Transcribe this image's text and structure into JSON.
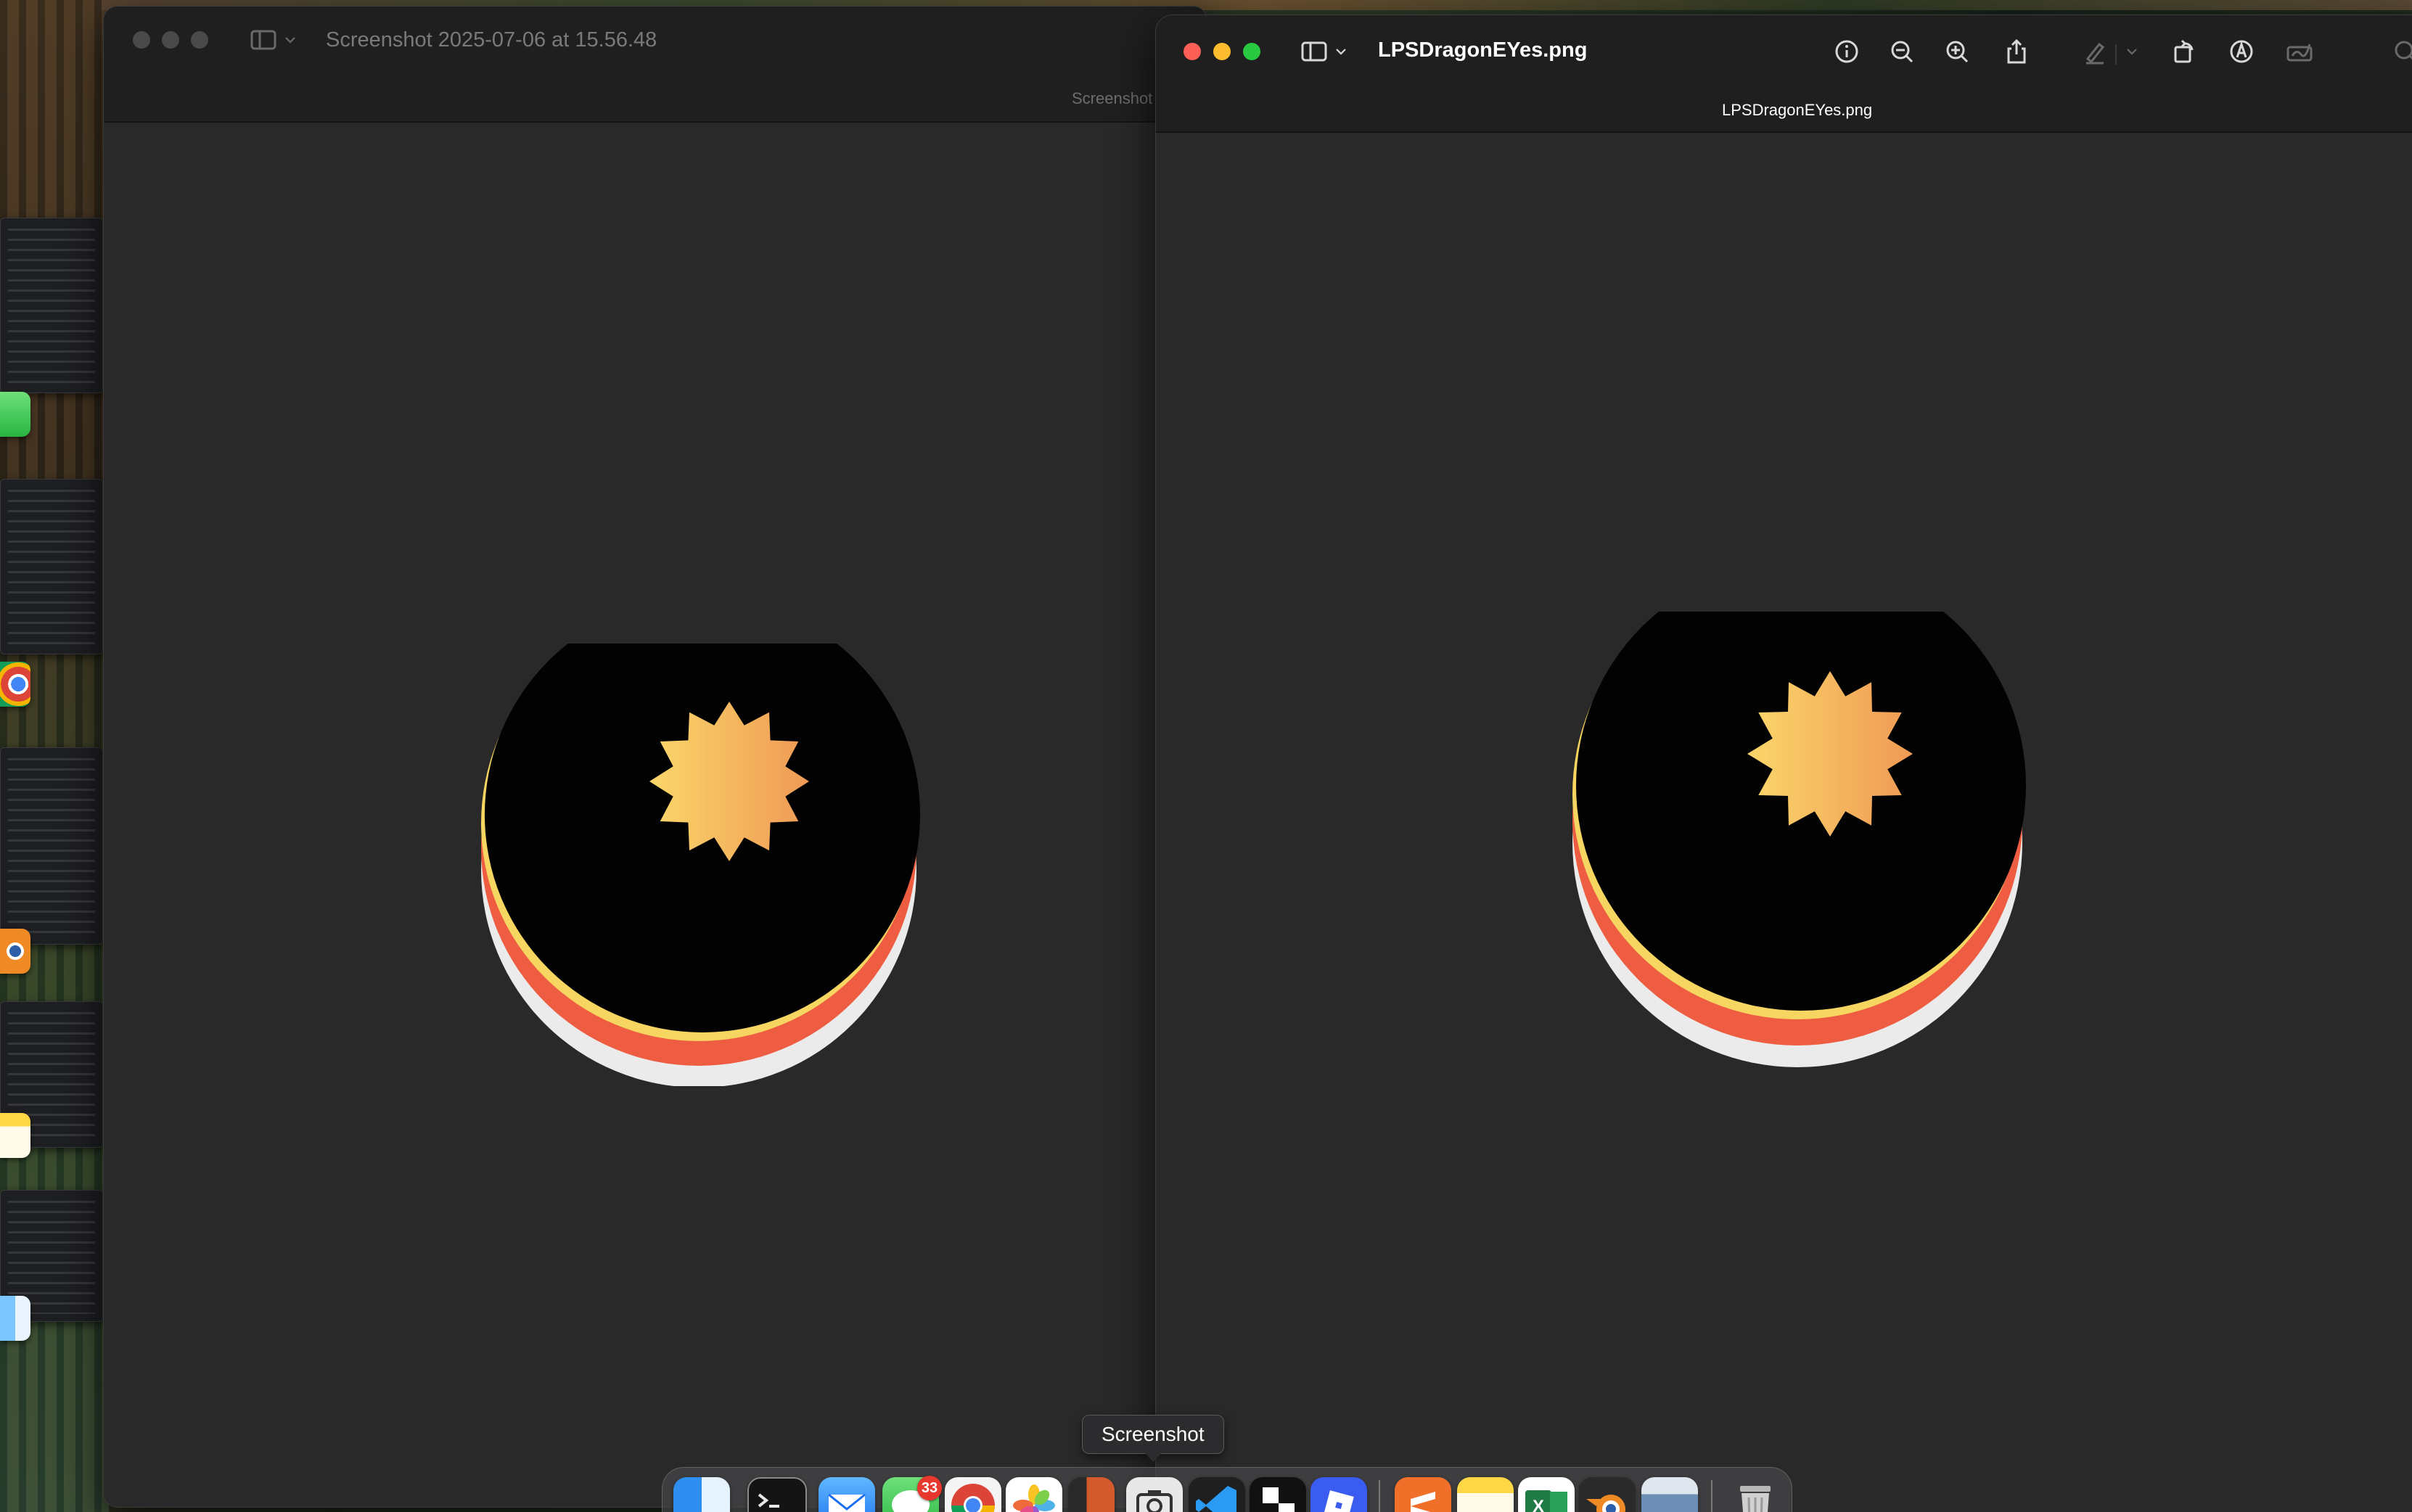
{
  "left_window": {
    "title": "Screenshot 2025-07-06 at 15.56.48",
    "subtitle": "Screenshot"
  },
  "right_window": {
    "title": "LPSDragonEYes.png",
    "subtitle": "LPSDragonEYes.png"
  },
  "toolbar_icons": [
    "sidebar-icon",
    "chevron-down-icon",
    "info-icon",
    "zoom-out-icon",
    "zoom-in-icon",
    "share-icon",
    "highlight-pen-icon",
    "rotate-icon",
    "markup-icon",
    "sign-icon",
    "search-icon"
  ],
  "dock": {
    "tooltip": "Screenshot",
    "messages_badge": "33",
    "apps": [
      "Finder",
      "Terminal",
      "Mail",
      "Messages",
      "Chrome",
      "Photos",
      "Calculator",
      "Screenshot",
      "VS Code",
      "Roblox Studio",
      "Roblox",
      "Sublime",
      "Notes",
      "Excel",
      "Blender",
      "Preview",
      "Trash"
    ]
  },
  "colors": {
    "window_bg": "#292929",
    "titlebar_bg": "#1f1f1f",
    "close": "#fe5f57",
    "minimize": "#febc2e",
    "zoom": "#28c840",
    "inactive_traffic": "#4a4a4a",
    "eye_black": "#020202",
    "eye_yellow": "#f7d561",
    "eye_red": "#ee5d41",
    "eye_white": "#ebebeb",
    "star_start": "#fbd66a",
    "star_end": "#ef9a55"
  }
}
